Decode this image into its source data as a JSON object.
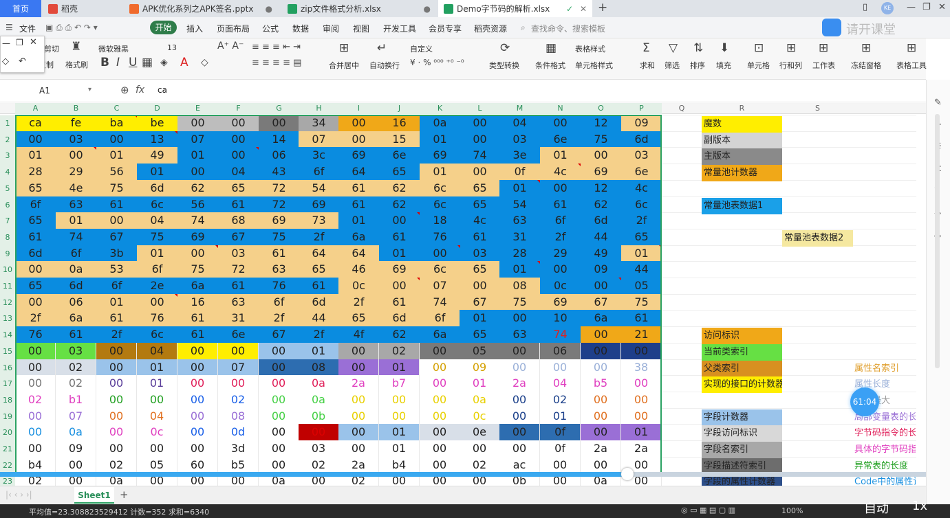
{
  "tabs": {
    "home": "首页",
    "daoke": "稻壳",
    "pptx": "APK优化系列之APK签名.pptx",
    "zip": "zip文件格式分析.xlsx",
    "demo": "Demo字节码的解析.xlsx"
  },
  "menu": {
    "file": "文件",
    "start": "开始",
    "insert": "插入",
    "layout": "页面布局",
    "formula": "公式",
    "data": "数据",
    "review": "审阅",
    "view": "视图",
    "dev": "开发工具",
    "member": "会员专享",
    "resources": "稻壳资源",
    "search": "查找命令、搜索模板",
    "watermark": "请开课堂"
  },
  "ribbon": {
    "cut": "剪切",
    "paste": "粘贴",
    "copy": "复制",
    "format_painter": "格式刷",
    "font": "微软雅黑",
    "size": "13",
    "bold": "B",
    "italic": "I",
    "underline": "U",
    "merge": "合并居中",
    "wrap": "自动换行",
    "numfmt": "自定义",
    "convert": "类型转换",
    "cond": "条件格式",
    "tablefmt": "表格样式",
    "cellfmt": "单元格样式",
    "sum": "求和",
    "filter": "筛选",
    "sort": "排序",
    "fill": "填充",
    "cell": "单元格",
    "rowcol": "行和列",
    "sheet": "工作表",
    "freeze": "冻结窗格",
    "tools": "表格工具"
  },
  "formula": {
    "cellref": "A1",
    "fx": "fx",
    "value": "ca"
  },
  "columns": [
    "A",
    "B",
    "C",
    "D",
    "E",
    "F",
    "G",
    "H",
    "I",
    "J",
    "K",
    "L",
    "M",
    "N",
    "O",
    "P",
    "Q",
    "R",
    "S"
  ],
  "rows": [
    "1",
    "2",
    "3",
    "4",
    "5",
    "6",
    "7",
    "8",
    "9",
    "10",
    "11",
    "12",
    "13",
    "14",
    "15",
    "16",
    "17",
    "18",
    "19",
    "20",
    "21",
    "22",
    "23"
  ],
  "hex": [
    [
      "ca",
      "fe",
      "ba",
      "be",
      "00",
      "00",
      "00",
      "34",
      "00",
      "16",
      "0a",
      "00",
      "04",
      "00",
      "12",
      "09"
    ],
    [
      "00",
      "03",
      "00",
      "13",
      "07",
      "00",
      "14",
      "07",
      "00",
      "15",
      "01",
      "00",
      "03",
      "6e",
      "75",
      "6d"
    ],
    [
      "01",
      "00",
      "01",
      "49",
      "01",
      "00",
      "06",
      "3c",
      "69",
      "6e",
      "69",
      "74",
      "3e",
      "01",
      "00",
      "03"
    ],
    [
      "28",
      "29",
      "56",
      "01",
      "00",
      "04",
      "43",
      "6f",
      "64",
      "65",
      "01",
      "00",
      "0f",
      "4c",
      "69",
      "6e"
    ],
    [
      "65",
      "4e",
      "75",
      "6d",
      "62",
      "65",
      "72",
      "54",
      "61",
      "62",
      "6c",
      "65",
      "01",
      "00",
      "12",
      "4c"
    ],
    [
      "6f",
      "63",
      "61",
      "6c",
      "56",
      "61",
      "72",
      "69",
      "61",
      "62",
      "6c",
      "65",
      "54",
      "61",
      "62",
      "6c"
    ],
    [
      "65",
      "01",
      "00",
      "04",
      "74",
      "68",
      "69",
      "73",
      "01",
      "00",
      "18",
      "4c",
      "63",
      "6f",
      "6d",
      "2f"
    ],
    [
      "61",
      "74",
      "67",
      "75",
      "69",
      "67",
      "75",
      "2f",
      "6a",
      "61",
      "76",
      "61",
      "31",
      "2f",
      "44",
      "65"
    ],
    [
      "6d",
      "6f",
      "3b",
      "01",
      "00",
      "03",
      "61",
      "64",
      "64",
      "01",
      "00",
      "03",
      "28",
      "29",
      "49",
      "01"
    ],
    [
      "00",
      "0a",
      "53",
      "6f",
      "75",
      "72",
      "63",
      "65",
      "46",
      "69",
      "6c",
      "65",
      "01",
      "00",
      "09",
      "44"
    ],
    [
      "65",
      "6d",
      "6f",
      "2e",
      "6a",
      "61",
      "76",
      "61",
      "0c",
      "00",
      "07",
      "00",
      "08",
      "0c",
      "00",
      "05"
    ],
    [
      "00",
      "06",
      "01",
      "00",
      "16",
      "63",
      "6f",
      "6d",
      "2f",
      "61",
      "74",
      "67",
      "75",
      "69",
      "67",
      "75"
    ],
    [
      "2f",
      "6a",
      "61",
      "76",
      "61",
      "31",
      "2f",
      "44",
      "65",
      "6d",
      "6f",
      "01",
      "00",
      "10",
      "6a",
      "61"
    ],
    [
      "76",
      "61",
      "2f",
      "6c",
      "61",
      "6e",
      "67",
      "2f",
      "4f",
      "62",
      "6a",
      "65",
      "63",
      "74",
      "00",
      "21"
    ],
    [
      "00",
      "03",
      "00",
      "04",
      "00",
      "00",
      "00",
      "01",
      "00",
      "02",
      "00",
      "05",
      "00",
      "06",
      "00",
      "00"
    ],
    [
      "00",
      "02",
      "00",
      "01",
      "00",
      "07",
      "00",
      "08",
      "00",
      "01",
      "00",
      "09",
      "00",
      "00",
      "00",
      "38"
    ],
    [
      "00",
      "02",
      "00",
      "01",
      "00",
      "00",
      "00",
      "0a",
      "2a",
      "b7",
      "00",
      "01",
      "2a",
      "04",
      "b5",
      "00"
    ],
    [
      "02",
      "b1",
      "00",
      "00",
      "00",
      "02",
      "00",
      "0a",
      "00",
      "00",
      "00",
      "0a",
      "00",
      "02",
      "00",
      "00"
    ],
    [
      "00",
      "07",
      "00",
      "04",
      "00",
      "08",
      "00",
      "0b",
      "00",
      "00",
      "00",
      "0c",
      "00",
      "01",
      "00",
      "00"
    ],
    [
      "00",
      "0a",
      "00",
      "0c",
      "00",
      "0d",
      "00",
      "00",
      "00",
      "01",
      "00",
      "0e",
      "00",
      "0f",
      "00",
      "01"
    ],
    [
      "00",
      "09",
      "00",
      "00",
      "00",
      "3d",
      "00",
      "03",
      "00",
      "01",
      "00",
      "00",
      "00",
      "0f",
      "2a",
      "2a"
    ],
    [
      "b4",
      "00",
      "02",
      "05",
      "60",
      "b5",
      "00",
      "02",
      "2a",
      "b4",
      "00",
      "02",
      "ac",
      "00",
      "00",
      "00"
    ],
    [
      "02",
      "00",
      "0a",
      "00",
      "00",
      "00",
      "0a",
      "00",
      "02",
      "00",
      "00",
      "00",
      "0b",
      "00",
      "0a",
      "00"
    ]
  ],
  "legend_r": [
    "魔数",
    "副版本",
    "主版本",
    "常量池计数器",
    "",
    "常量池表数据1",
    "",
    "",
    "",
    "",
    "",
    "",
    "",
    "访问标识",
    "当前类索引",
    "父类索引",
    "实现的接口的计数器",
    "",
    "字段计数器",
    "字段访问标识",
    "字段名索引",
    "字段描述符索引",
    "字段的属性计数器"
  ],
  "legend_s": {
    "r8": "常量池表数据2",
    "r16": "属性名索引",
    "r17": "属性长度",
    "r18": "栈的最大",
    "r19": "局部变量表的长",
    "r20": "字节码指令的长",
    "r21": "具体的字节码指",
    "r22": "异常表的长度",
    "r23": "Code中的属性计"
  },
  "sheet": {
    "name": "Sheet1",
    "add": "+"
  },
  "status": {
    "stats": "平均值=23.308823529412  计数=352  求和=6340",
    "zoom": "100%",
    "auto": "自动",
    "speed": "1x"
  },
  "timer": "61:04",
  "colors": {
    "yellow": "#ffee00",
    "sand": "#f5d08a",
    "blue": "#0a8ce0",
    "orange": "#f0a818",
    "green": "#2aa262",
    "greenhi": "#66e044"
  }
}
